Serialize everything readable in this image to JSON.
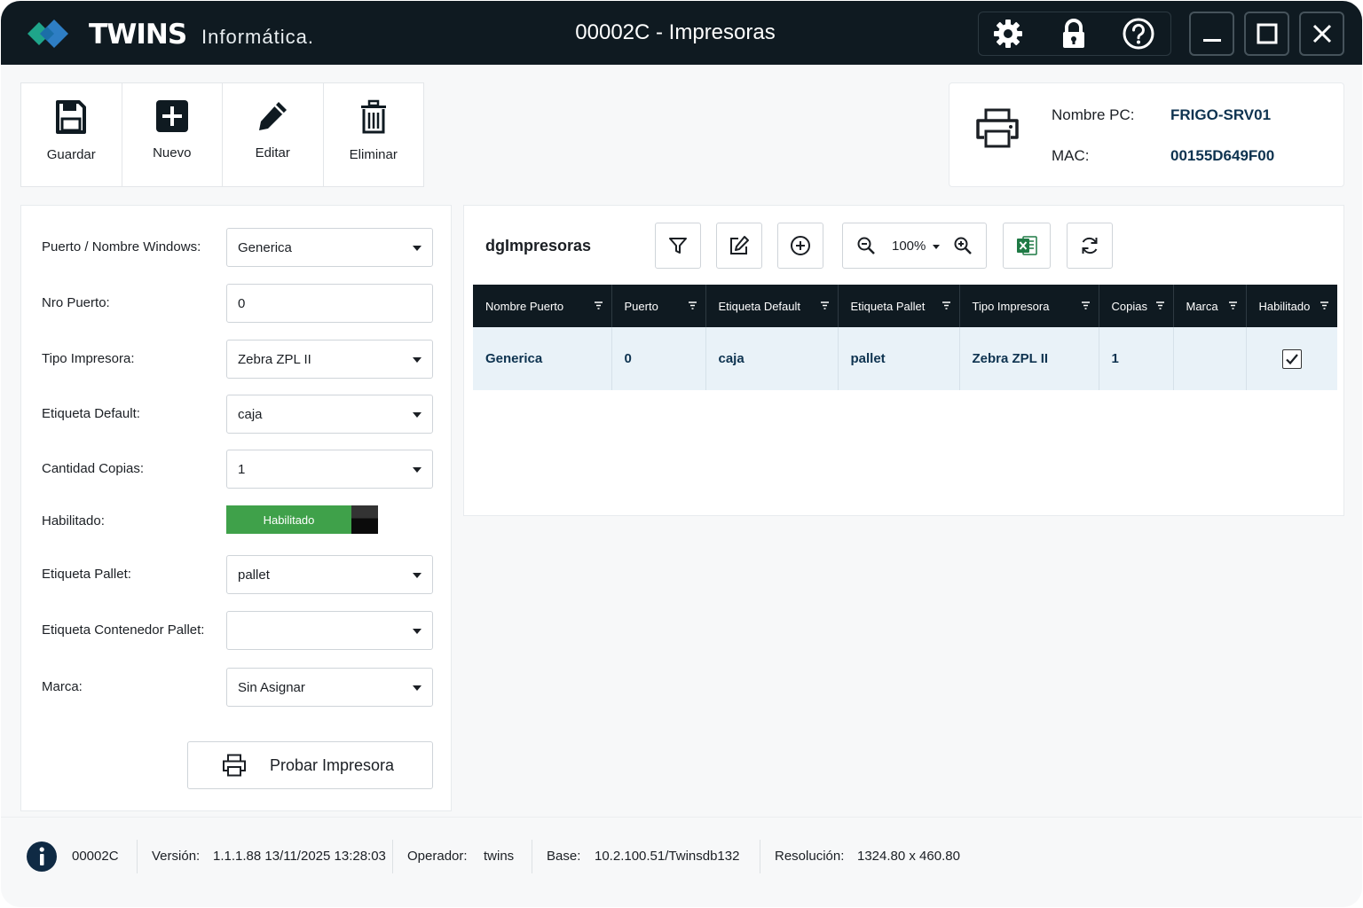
{
  "titlebar": {
    "brand": "TWINS",
    "brand_sub": "Informática.",
    "window_title": "00002C - Impresoras",
    "buttons": [
      "gear-icon",
      "lock-icon",
      "help-icon",
      "minimize-icon",
      "maximize-icon",
      "close-icon"
    ]
  },
  "toolbar": {
    "save_label": "Guardar",
    "new_label": "Nuevo",
    "edit_label": "Editar",
    "delete_label": "Eliminar"
  },
  "pc_info": {
    "name_label": "Nombre PC:",
    "name_value": "FRIGO-SRV01",
    "mac_label": "MAC:",
    "mac_value": "00155D649F00"
  },
  "form": {
    "puerto_label": "Puerto / Nombre Windows:",
    "puerto_value": "Generica",
    "nro_puerto_label": "Nro Puerto:",
    "nro_puerto_value": "0",
    "tipo_label": "Tipo Impresora:",
    "tipo_value": "Zebra ZPL II",
    "etq_default_label": "Etiqueta Default:",
    "etq_default_value": "caja",
    "copias_label": "Cantidad Copias:",
    "copias_value": "1",
    "habilitado_label": "Habilitado:",
    "habilitado_toggle": "Habilitado",
    "etq_pallet_label": "Etiqueta Pallet:",
    "etq_pallet_value": "pallet",
    "etq_contenedor_label": "Etiqueta Contenedor Pallet:",
    "etq_contenedor_value": "",
    "marca_label": "Marca:",
    "marca_value": "Sin Asignar",
    "probar_label": "Probar Impresora"
  },
  "grid": {
    "title": "dgImpresoras",
    "zoom": "100%",
    "columns": [
      "Nombre Puerto",
      "Puerto",
      "Etiqueta Default",
      "Etiqueta Pallet",
      "Tipo Impresora",
      "Copias",
      "Marca",
      "Habilitado"
    ],
    "rows": [
      {
        "nombre_puerto": "Generica",
        "puerto": "0",
        "etiqueta_default": "caja",
        "etiqueta_pallet": "pallet",
        "tipo_impresora": "Zebra ZPL II",
        "copias": "1",
        "marca": "",
        "habilitado": true
      }
    ]
  },
  "statusbar": {
    "code": "00002C",
    "version_label": "Versión:",
    "version_value": "1.1.1.88 13/11/2025 13:28:03",
    "operator_label": "Operador:",
    "operator_value": "twins",
    "base_label": "Base:",
    "base_value": "10.2.100.51/Twinsdb132",
    "resolution_label": "Resolución:",
    "resolution_value": "1324.80 x 460.80"
  },
  "colors": {
    "titlebar_bg": "#0f1a21",
    "accent_green": "#3fa14a",
    "value_blue": "#0e3350",
    "row_highlight": "#e9f2f8",
    "logo_teal": "#1fa58a",
    "logo_blue": "#2e7ec4"
  }
}
